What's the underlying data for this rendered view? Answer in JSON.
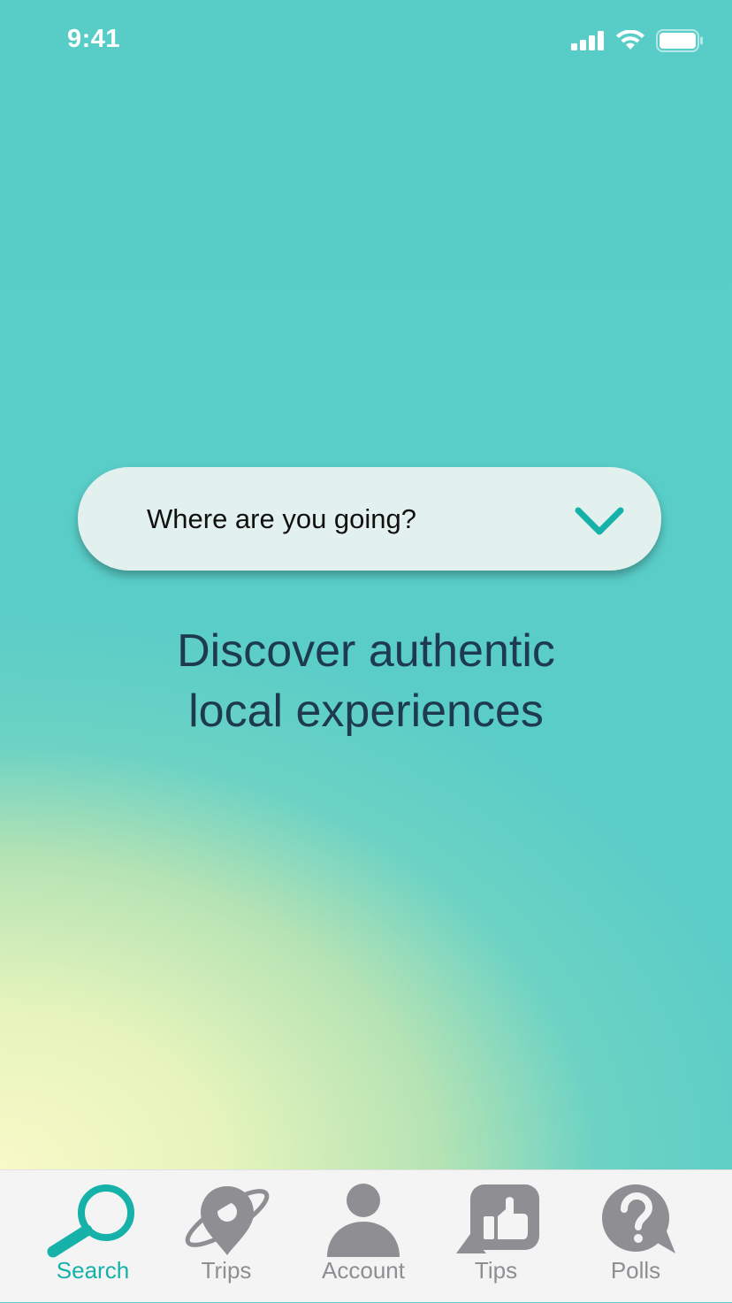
{
  "status_bar": {
    "time": "9:41",
    "icons": [
      "cellular-signal-icon",
      "wifi-icon",
      "battery-icon"
    ]
  },
  "search": {
    "placeholder": "Where are you going?",
    "dropdown_icon": "chevron-down-icon"
  },
  "tagline": {
    "line1": "Discover authentic",
    "line2": "local experiences"
  },
  "tab_bar": {
    "active_tab": "Search",
    "tabs": [
      {
        "label": "Search",
        "icon": "search-icon"
      },
      {
        "label": "Trips",
        "icon": "trips-icon"
      },
      {
        "label": "Account",
        "icon": "account-icon"
      },
      {
        "label": "Tips",
        "icon": "tips-icon"
      },
      {
        "label": "Polls",
        "icon": "polls-icon"
      }
    ]
  },
  "colors": {
    "accent": "#16b1a9",
    "background_teal": "#5ccdc8",
    "gradient_yellow": "#f8f9c8",
    "tagline_text": "#1d3a4e",
    "inactive_tab": "#8e8e93",
    "search_box_bg": "#e2f0ee"
  }
}
